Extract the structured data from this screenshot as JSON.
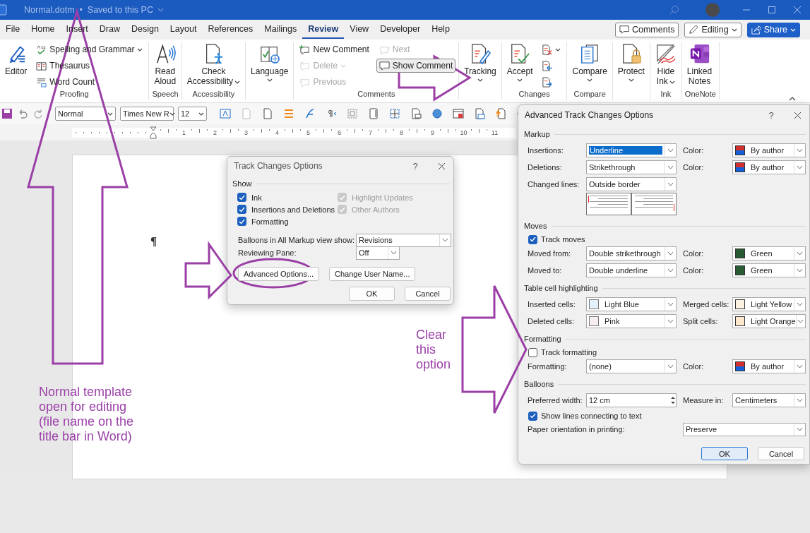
{
  "window": {
    "title": "Normal.dotm  •  Saved to this PC"
  },
  "menu_tabs": [
    {
      "label": "File",
      "selected": false
    },
    {
      "label": "Home",
      "selected": false
    },
    {
      "label": "Insert",
      "selected": false
    },
    {
      "label": "Draw",
      "selected": false
    },
    {
      "label": "Design",
      "selected": false
    },
    {
      "label": "Layout",
      "selected": false
    },
    {
      "label": "References",
      "selected": false
    },
    {
      "label": "Mailings",
      "selected": false
    },
    {
      "label": "Review",
      "selected": true
    },
    {
      "label": "View",
      "selected": false
    },
    {
      "label": "Developer",
      "selected": false
    },
    {
      "label": "Help",
      "selected": false
    }
  ],
  "header_buttons": [
    {
      "kind": "outline",
      "label": "Comments",
      "dropdown": false
    },
    {
      "kind": "outline",
      "label": "Editing",
      "dropdown": true
    },
    {
      "kind": "primary",
      "label": "Share",
      "dropdown": true
    }
  ],
  "ribbon": {
    "groups": [
      {
        "label": "Proofing",
        "items": [
          {
            "kind": "large",
            "lines": [
              "Editor"
            ],
            "dropdown": false
          },
          {
            "kind": "stack",
            "items": [
              {
                "label": "Spelling and Grammar",
                "dropdown": true,
                "disabled": false
              },
              {
                "label": "Thesaurus",
                "dropdown": false,
                "disabled": false
              },
              {
                "label": "Word Count",
                "dropdown": false,
                "disabled": false
              }
            ]
          }
        ]
      },
      {
        "label": "Speech",
        "items": [
          {
            "kind": "large",
            "lines": [
              "Read",
              "Aloud"
            ],
            "dropdown": false
          }
        ]
      },
      {
        "label": "Accessibility",
        "items": [
          {
            "kind": "large",
            "lines": [
              "Check",
              "Accessibility"
            ],
            "dropdown": true
          }
        ]
      },
      {
        "items": [
          {
            "kind": "large",
            "lines": [
              "Language"
            ],
            "dropdown": true
          }
        ]
      },
      {
        "label": "Comments",
        "items": [
          {
            "kind": "stack",
            "items": [
              {
                "label": "New Comment",
                "dropdown": false,
                "disabled": false
              },
              {
                "label": "Delete",
                "dropdown": true,
                "disabled": true
              },
              {
                "label": "Previous",
                "dropdown": false,
                "disabled": true
              }
            ]
          },
          {
            "kind": "stack",
            "items": [
              {
                "label": "Next",
                "dropdown": false,
                "disabled": true
              },
              {
                "label": "Show Comment",
                "dropdown": false,
                "disabled": false,
                "pressed": true
              }
            ]
          }
        ]
      },
      {
        "items": [
          {
            "kind": "large",
            "lines": [
              "Tracking"
            ],
            "dropdown": true
          }
        ]
      },
      {
        "label": "Changes",
        "items": [
          {
            "kind": "large",
            "lines": [
              "Accept"
            ],
            "dropdown": true
          },
          {
            "kind": "stack",
            "items": [
              {
                "dropdown": true,
                "disabled": false
              },
              {
                "dropdown": false,
                "disabled": false
              },
              {
                "dropdown": false,
                "disabled": false
              }
            ]
          }
        ]
      },
      {
        "label": "Compare",
        "items": [
          {
            "kind": "large",
            "lines": [
              "Compare"
            ],
            "dropdown": true
          }
        ]
      },
      {
        "items": [
          {
            "kind": "large",
            "lines": [
              "Protect"
            ],
            "dropdown": true
          }
        ]
      },
      {
        "label": "Ink",
        "items": [
          {
            "kind": "large",
            "lines": [
              "Hide",
              "Ink"
            ],
            "dropdown": true
          }
        ]
      },
      {
        "label": "OneNote",
        "items": [
          {
            "kind": "large",
            "lines": [
              "Linked",
              "Notes"
            ],
            "dropdown": false
          }
        ]
      }
    ]
  },
  "toolbar": {
    "style": "Normal",
    "font": "Times New R",
    "size": "12"
  },
  "ruler": {
    "numbers": [
      "1",
      "2",
      "3",
      "4",
      "5",
      "6",
      "7",
      "8",
      "9",
      "10",
      "11"
    ]
  },
  "document": {
    "paragraph_mark": "¶"
  },
  "track_changes_dialog": {
    "title": "Track Changes Options",
    "help": "?",
    "heading": "Show",
    "options": [
      {
        "label": "Ink",
        "checked": true,
        "disabled": false
      },
      {
        "label": "Highlight Updates",
        "checked": true,
        "disabled": true
      },
      {
        "label": "Insertions and Deletions",
        "checked": true,
        "disabled": false
      },
      {
        "label": "Other Authors",
        "checked": true,
        "disabled": true
      },
      {
        "label": "Formatting",
        "checked": true,
        "disabled": false
      }
    ],
    "fields": [
      {
        "label": "Balloons in All Markup view show:",
        "value": "Revisions"
      },
      {
        "label": "Reviewing Pane:",
        "value": "Off"
      }
    ],
    "buttons": [
      {
        "label": "Advanced Options..."
      },
      {
        "label": "Change User Name..."
      }
    ],
    "footer_buttons": [
      {
        "label": "OK",
        "default": false
      },
      {
        "label": "Cancel",
        "default": false
      }
    ]
  },
  "advanced_dialog": {
    "title": "Advanced Track Changes Options",
    "help": "?",
    "sections": [
      {
        "heading": "Markup",
        "rows": [
          {
            "kind": "pair",
            "label": "Insertions:",
            "value": "Underline",
            "focused": true,
            "color_label": "Color:",
            "color_value": "By author",
            "swatch": {
              "kind": "split"
            }
          },
          {
            "kind": "pair",
            "label": "Deletions:",
            "value": "Strikethrough",
            "focused": false,
            "color_label": "Color:",
            "color_value": "By author",
            "swatch": {
              "kind": "split"
            }
          },
          {
            "kind": "single",
            "label": "Changed lines:",
            "value": "Outside border"
          },
          {
            "kind": "preview"
          }
        ]
      },
      {
        "heading": "Moves",
        "rows": [
          {
            "kind": "checkbox",
            "label": "Track moves",
            "checked": true
          },
          {
            "kind": "pair",
            "label": "Moved from:",
            "value": "Double strikethrough",
            "focused": false,
            "color_label": "Color:",
            "color_value": "Green",
            "swatch": {
              "kind": "solid",
              "color": "#285a33"
            }
          },
          {
            "kind": "pair",
            "label": "Moved to:",
            "value": "Double underline",
            "focused": false,
            "color_label": "Color:",
            "color_value": "Green",
            "swatch": {
              "kind": "solid",
              "color": "#285a33"
            }
          }
        ]
      },
      {
        "heading": "Table cell highlighting",
        "rows": [
          {
            "kind": "pair",
            "label": "Inserted cells:",
            "value": "Light Blue",
            "value_swatch": {
              "color": "#e4f1fa"
            },
            "focused": false,
            "color_label": "Merged cells:",
            "color_value": "Light Yellow",
            "swatch": {
              "kind": "solid",
              "color": "#fbf2e2"
            }
          },
          {
            "kind": "pair",
            "label": "Deleted cells:",
            "value": "Pink",
            "value_swatch": {
              "color": "#f8eef0"
            },
            "focused": false,
            "color_label": "Split cells:",
            "color_value": "Light Orange",
            "swatch": {
              "kind": "solid",
              "color": "#fce9cd"
            }
          }
        ]
      },
      {
        "heading": "Formatting",
        "rows": [
          {
            "kind": "checkbox",
            "label": "Track formatting",
            "checked": false
          },
          {
            "kind": "pair",
            "label": "Formatting:",
            "value": "(none)",
            "focused": false,
            "color_label": "Color:",
            "color_value": "By author",
            "swatch": {
              "kind": "split"
            }
          }
        ]
      },
      {
        "heading": "Balloons",
        "rows": [
          {
            "kind": "spin",
            "label": "Preferred width:",
            "value": "12 cm",
            "color_label": "Measure in:",
            "color_value": "Centimeters"
          },
          {
            "kind": "checkbox",
            "label": "Show lines connecting to text",
            "checked": true
          },
          {
            "kind": "wide",
            "label": "Paper orientation in printing:",
            "value": "Preserve"
          }
        ]
      }
    ],
    "footer_buttons": [
      {
        "label": "OK",
        "default": true
      },
      {
        "label": "Cancel",
        "default": false
      }
    ]
  },
  "annotations": [
    {
      "kind": "note",
      "text": "Normal template\nopen for editing\n(file name on the\ntitle bar in Word)"
    },
    {
      "kind": "note",
      "text": "Clear\nthis\noption"
    }
  ]
}
